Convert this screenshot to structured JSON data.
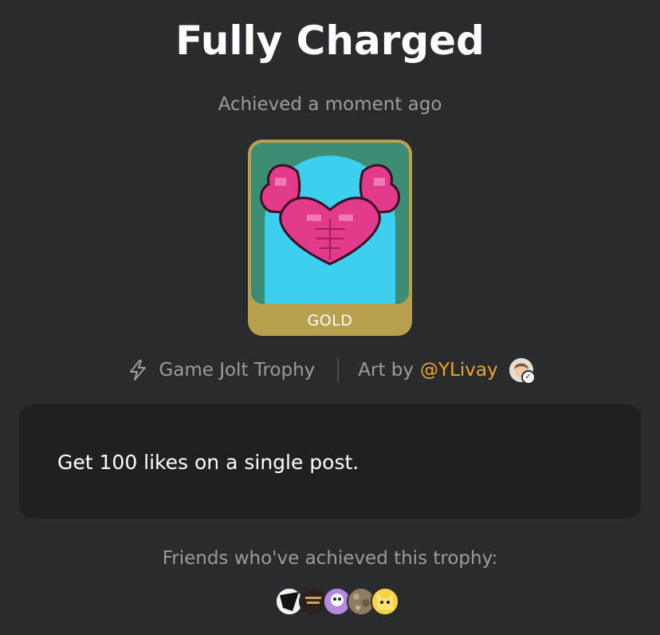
{
  "trophy": {
    "title": "Fully Charged",
    "achieved": "Achieved a moment ago",
    "tier": "GOLD",
    "description": "Get 100 likes on a single post."
  },
  "meta": {
    "source_icon": "bolt-icon",
    "source": "Game Jolt Trophy",
    "art_by_label": "Art by",
    "artist": "@YLivay"
  },
  "friends": {
    "label": "Friends who've achieved this trophy:",
    "avatars": [
      "friend-avatar-1",
      "friend-avatar-2",
      "friend-avatar-3",
      "friend-avatar-4",
      "friend-avatar-5"
    ]
  },
  "colors": {
    "background": "#2a2b2e",
    "card_gold": "#b9a04f",
    "link": "#f5a623",
    "description_bg": "#1f2022"
  }
}
